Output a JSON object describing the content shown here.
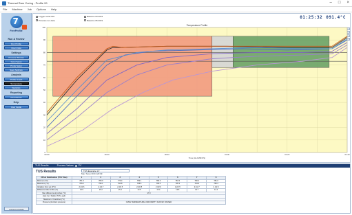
{
  "window": {
    "title": "Thermal Ram Curing - Profile 99",
    "controls": [
      "–",
      "□",
      "×"
    ]
  },
  "menu": [
    "File",
    "Machine",
    "Job",
    "Options",
    "Help"
  ],
  "sidebar": {
    "logo_text": "FreeProfile",
    "sections": [
      {
        "label": "Run & Review",
        "buttons": [
          "Run Profile",
          "Open Data"
        ]
      },
      {
        "label": "Settings",
        "buttons": [
          "Process Window",
          "Oven Setup",
          "Probe Setup",
          "Save Settings"
        ]
      },
      {
        "label": "Analysis",
        "buttons": [
          "Profile Graph",
          "Temperature",
          "Statistics"
        ]
      },
      {
        "label": "Reporting",
        "buttons": [
          "Print Report"
        ]
      },
      {
        "label": "Help",
        "buttons": [
          "User Guide"
        ]
      }
    ],
    "active_button": "Temperature",
    "bottom_button": "Advanced Mode"
  },
  "graph": {
    "legend": [
      {
        "label": "Logger serial 001",
        "checked": true
      },
      {
        "label": "Baseline 03 2019",
        "checked": true
      },
      {
        "label": "Previous run data",
        "checked": false
      },
      {
        "label": "Baseline 05 2019",
        "checked": false
      }
    ],
    "title": "Temperature Profile",
    "readouts": [
      "01:25:32",
      "091.4°C"
    ],
    "icon_names": [
      "pen-tool-icon",
      "zoom-icon",
      "print-icon",
      "settings-icon"
    ]
  },
  "chart_data": {
    "type": "line",
    "title": "Temperature Profile",
    "xlabel": "Time (HH:MM:SS)",
    "ylabel": "",
    "xlim": [
      0,
      100
    ],
    "ylim": [
      0,
      100
    ],
    "x_ticks": [
      "00:00",
      "00:20",
      "00:40",
      "01:00",
      "01:20",
      "01:40"
    ],
    "y_ticks": [
      "100",
      "90",
      "80",
      "70",
      "60",
      "50",
      "40",
      "30",
      "20",
      "10",
      "0"
    ],
    "grid": true,
    "zones": [
      {
        "name": "ramp",
        "x": [
          2,
          55
        ],
        "y": [
          45,
          93
        ],
        "color": "#f39b80"
      },
      {
        "name": "transition",
        "x": [
          55,
          62
        ],
        "y": [
          68,
          93
        ],
        "color": "#d6d6d6"
      },
      {
        "name": "hold",
        "x": [
          62,
          94
        ],
        "y": [
          68,
          93
        ],
        "color": "#6ba368"
      }
    ],
    "reference_lines": [
      {
        "y": 80
      },
      {
        "y": 73
      }
    ],
    "series": [
      {
        "color": "#333333",
        "x": [
          0,
          10,
          20,
          22,
          25,
          40,
          60,
          80,
          95,
          100
        ],
        "y": [
          30,
          58,
          82,
          84,
          84,
          85,
          85,
          84,
          84,
          92
        ]
      },
      {
        "color": "#c55a1a",
        "x": [
          0,
          10,
          20,
          22,
          25,
          40,
          60,
          80,
          95,
          100
        ],
        "y": [
          32,
          60,
          83,
          85,
          84,
          85,
          85,
          85,
          85,
          93
        ]
      },
      {
        "color": "#4d6fc2",
        "x": [
          0,
          10,
          20,
          26,
          35,
          50,
          65,
          80,
          95,
          100
        ],
        "y": [
          20,
          45,
          70,
          78,
          81,
          82,
          83,
          82,
          83,
          90
        ]
      },
      {
        "color": "#7f66c7",
        "x": [
          0,
          10,
          20,
          30,
          40,
          55,
          70,
          85,
          95,
          100
        ],
        "y": [
          15,
          35,
          58,
          70,
          76,
          79,
          80,
          80,
          81,
          88
        ]
      },
      {
        "color": "#9a7fcc",
        "x": [
          0,
          10,
          20,
          30,
          40,
          55,
          70,
          85,
          95,
          100
        ],
        "y": [
          10,
          28,
          48,
          62,
          70,
          75,
          77,
          78,
          79,
          86
        ]
      },
      {
        "color": "#b996d6",
        "x": [
          0,
          12,
          22,
          32,
          42,
          55,
          70,
          85,
          95,
          100
        ],
        "y": [
          5,
          18,
          35,
          48,
          58,
          65,
          70,
          73,
          76,
          84
        ]
      },
      {
        "color": "#5a8fd1",
        "x": [
          0,
          10,
          20,
          30,
          40,
          55,
          70,
          85,
          95,
          100
        ],
        "y": [
          25,
          50,
          74,
          80,
          82,
          83,
          84,
          83,
          83,
          91
        ]
      }
    ]
  },
  "results": {
    "header": "TUS Results",
    "pv_toggle": "Process Values",
    "pv_label": "PV",
    "title": "TUS Results",
    "dropdown": "TUS Example 1 ▾",
    "sub": "Max Temp 00:43:20:09",
    "columns": [
      "Offset Stabilisation (TUS Time)",
      "1",
      "2",
      "3",
      "4",
      "5",
      "6",
      "7",
      "8"
    ],
    "rows": [
      {
        "label": "Minimum (°C)",
        "values": [
          "781.3",
          "780.9",
          "779.4",
          "782.1",
          "780.6",
          "781.5",
          "780.2",
          "781.0"
        ]
      },
      {
        "label": "Maximum (°C)",
        "values": [
          "795.2",
          "796.1",
          "794.8",
          "795.6",
          "796.0",
          "795.3",
          "794.9",
          "795.4"
        ]
      },
      {
        "label": "Variation from set (±°C)",
        "values": [
          "2.2/2.6",
          "2.1/2.7",
          "2.4/2.5",
          "2.0/2.8",
          "2.3/2.6",
          "2.2/2.5",
          "2.4/2.7",
          "2.1/2.6"
        ]
      },
      {
        "label": "Difference Max & Min (°C)",
        "values": [
          "13.9",
          "15.2",
          "15.4",
          "13.5",
          "15.4",
          "13.8",
          "14.7",
          "14.4"
        ]
      },
      {
        "label": "Max difference all probes (°C)",
        "values": [
          "17.0"
        ]
      },
      {
        "label": "Heat Up / Stable (TUS Lead)",
        "values": [
          ""
        ]
      },
      {
        "label": "Maximum / Overshoot (°C)",
        "values": [
          ""
        ]
      },
      {
        "label": "Pressure (Ambient pressure)",
        "values": [
          "OVEN TEMPERATURE UNIFORMITY SURVEY PASSED"
        ]
      }
    ]
  }
}
